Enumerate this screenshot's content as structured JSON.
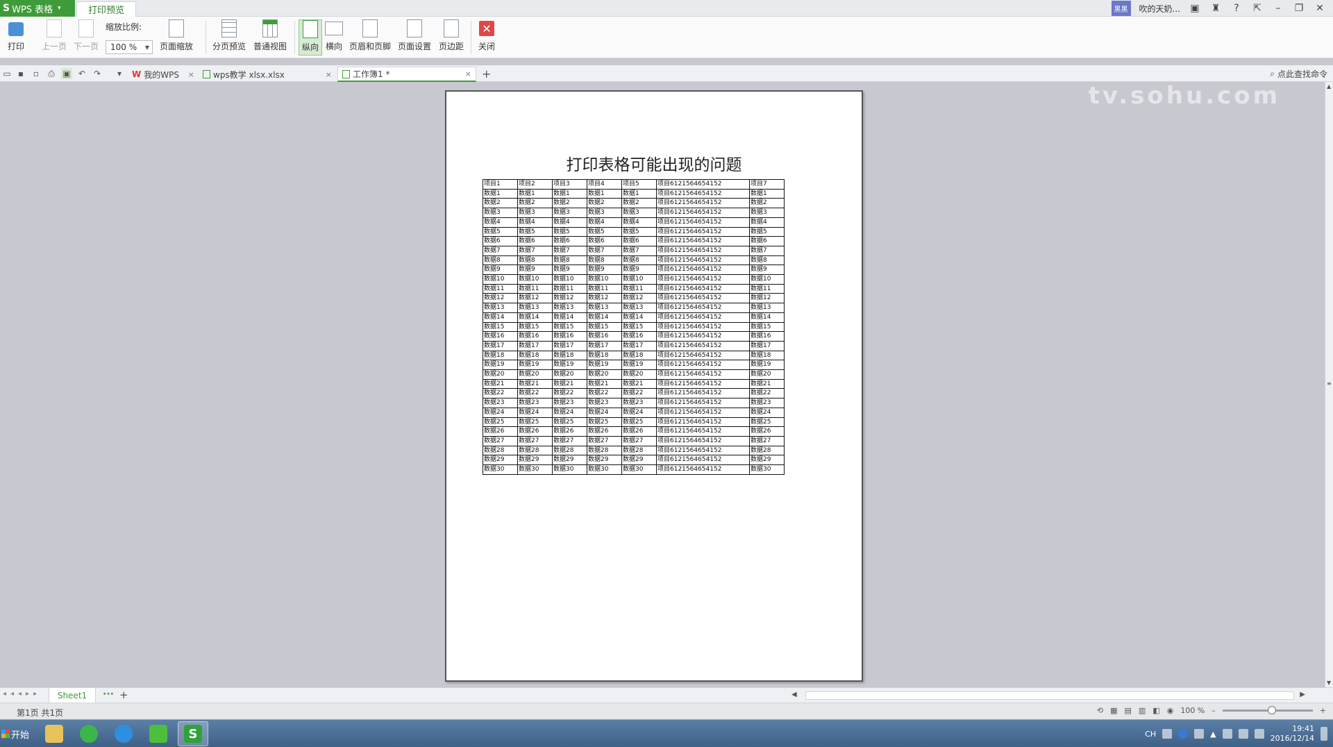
{
  "titlebar": {
    "app_name": "WPS 表格",
    "active_tab": "打印预览",
    "user_name": "吹的天奶...",
    "avatar_text": "黑黑"
  },
  "ribbon": {
    "print": "打印",
    "prev_page": "上一页",
    "next_page": "下一页",
    "zoom_label": "缩放比例:",
    "zoom_value": "100 %",
    "page_scaling": "页面缩放",
    "page_break_preview": "分页预览",
    "normal_view": "普通视图",
    "portrait": "纵向",
    "landscape": "横向",
    "header_footer": "页眉和页脚",
    "page_setup": "页面设置",
    "margins": "页边距",
    "close": "关闭"
  },
  "docbar": {
    "tabs": [
      {
        "label": "我的WPS"
      },
      {
        "label": "wps教学 xlsx.xlsx"
      },
      {
        "label": "工作簿1 *"
      }
    ],
    "command_search": "点此查找命令"
  },
  "watermark": "tv.sohu.com",
  "page": {
    "title": "打印表格可能出现的问题",
    "rows": [
      [
        "项目1",
        "项目2",
        "项目3",
        "项目4",
        "项目5",
        "项目6121564654152",
        "项目7"
      ],
      [
        "数据1",
        "数据1",
        "数据1",
        "数据1",
        "数据1",
        "项目6121564654152",
        "数据1"
      ],
      [
        "数据2",
        "数据2",
        "数据2",
        "数据2",
        "数据2",
        "项目6121564654152",
        "数据2"
      ],
      [
        "数据3",
        "数据3",
        "数据3",
        "数据3",
        "数据3",
        "项目6121564654152",
        "数据3"
      ],
      [
        "数据4",
        "数据4",
        "数据4",
        "数据4",
        "数据4",
        "项目6121564654152",
        "数据4"
      ],
      [
        "数据5",
        "数据5",
        "数据5",
        "数据5",
        "数据5",
        "项目6121564654152",
        "数据5"
      ],
      [
        "数据6",
        "数据6",
        "数据6",
        "数据6",
        "数据6",
        "项目6121564654152",
        "数据6"
      ],
      [
        "数据7",
        "数据7",
        "数据7",
        "数据7",
        "数据7",
        "项目6121564654152",
        "数据7"
      ],
      [
        "数据8",
        "数据8",
        "数据8",
        "数据8",
        "数据8",
        "项目6121564654152",
        "数据8"
      ],
      [
        "数据9",
        "数据9",
        "数据9",
        "数据9",
        "数据9",
        "项目6121564654152",
        "数据9"
      ],
      [
        "数据10",
        "数据10",
        "数据10",
        "数据10",
        "数据10",
        "项目6121564654152",
        "数据10"
      ],
      [
        "数据11",
        "数据11",
        "数据11",
        "数据11",
        "数据11",
        "项目6121564654152",
        "数据11"
      ],
      [
        "数据12",
        "数据12",
        "数据12",
        "数据12",
        "数据12",
        "项目6121564654152",
        "数据12"
      ],
      [
        "数据13",
        "数据13",
        "数据13",
        "数据13",
        "数据13",
        "项目6121564654152",
        "数据13"
      ],
      [
        "数据14",
        "数据14",
        "数据14",
        "数据14",
        "数据14",
        "项目6121564654152",
        "数据14"
      ],
      [
        "数据15",
        "数据15",
        "数据15",
        "数据15",
        "数据15",
        "项目6121564654152",
        "数据15"
      ],
      [
        "数据16",
        "数据16",
        "数据16",
        "数据16",
        "数据16",
        "项目6121564654152",
        "数据16"
      ],
      [
        "数据17",
        "数据17",
        "数据17",
        "数据17",
        "数据17",
        "项目6121564654152",
        "数据17"
      ],
      [
        "数据18",
        "数据18",
        "数据18",
        "数据18",
        "数据18",
        "项目6121564654152",
        "数据18"
      ],
      [
        "数据19",
        "数据19",
        "数据19",
        "数据19",
        "数据19",
        "项目6121564654152",
        "数据19"
      ],
      [
        "数据20",
        "数据20",
        "数据20",
        "数据20",
        "数据20",
        "项目6121564654152",
        "数据20"
      ],
      [
        "数据21",
        "数据21",
        "数据21",
        "数据21",
        "数据21",
        "项目6121564654152",
        "数据21"
      ],
      [
        "数据22",
        "数据22",
        "数据22",
        "数据22",
        "数据22",
        "项目6121564654152",
        "数据22"
      ],
      [
        "数据23",
        "数据23",
        "数据23",
        "数据23",
        "数据23",
        "项目6121564654152",
        "数据23"
      ],
      [
        "数据24",
        "数据24",
        "数据24",
        "数据24",
        "数据24",
        "项目6121564654152",
        "数据24"
      ],
      [
        "数据25",
        "数据25",
        "数据25",
        "数据25",
        "数据25",
        "项目6121564654152",
        "数据25"
      ],
      [
        "数据26",
        "数据26",
        "数据26",
        "数据26",
        "数据26",
        "项目6121564654152",
        "数据26"
      ],
      [
        "数据27",
        "数据27",
        "数据27",
        "数据27",
        "数据27",
        "项目6121564654152",
        "数据27"
      ],
      [
        "数据28",
        "数据28",
        "数据28",
        "数据28",
        "数据28",
        "项目6121564654152",
        "数据28"
      ],
      [
        "数据29",
        "数据29",
        "数据29",
        "数据29",
        "数据29",
        "项目6121564654152",
        "数据29"
      ],
      [
        "数据30",
        "数据30",
        "数据30",
        "数据30",
        "数据30",
        "项目6121564654152",
        "数据30"
      ]
    ]
  },
  "sheetbar": {
    "sheet_name": "Sheet1",
    "more": "···",
    "add": "+"
  },
  "statusbar": {
    "page_info": "第1页 共1页",
    "zoom": "100 %"
  },
  "taskbar": {
    "start": "开始",
    "ime": "CH",
    "time": "19:41",
    "date": "2016/12/14"
  },
  "icons": {
    "print": "printer-icon",
    "close": "close-icon",
    "colors": {
      "wps_green": "#3f9b3a",
      "close_red": "#e04848"
    }
  }
}
